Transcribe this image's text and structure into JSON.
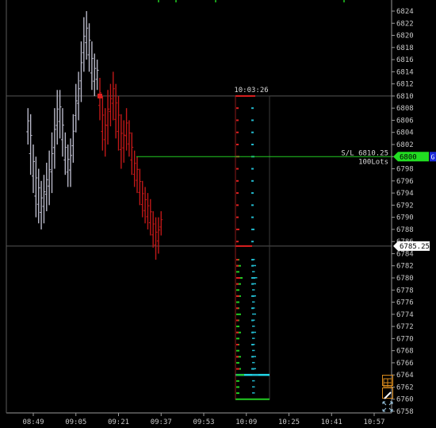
{
  "chart_data": {
    "type": "ohlc",
    "colors": {
      "background": "#000000",
      "bars_before": "#b8b8c8",
      "bars_after": "#c01818",
      "ladder_green": "#22cc22",
      "ladder_cyan": "#22b8cc",
      "sl_line": "#22cc22",
      "price_marker": "#ffffff",
      "tool_orange": "#d98a1c"
    },
    "ylim": [
      6757,
      6826
    ],
    "y_ticks": [
      "6824",
      "6822",
      "6820",
      "6818",
      "6816",
      "6814",
      "6812",
      "6810",
      "6808",
      "6806",
      "6804",
      "6802",
      "6800",
      "6798",
      "6796",
      "6794",
      "6792",
      "6790",
      "6788",
      "6786",
      "6784",
      "6782",
      "6780",
      "6778",
      "6776",
      "6774",
      "6772",
      "6770",
      "6768",
      "6766",
      "6764",
      "6762",
      "6760",
      "6758"
    ],
    "x_ticks": [
      "08:49",
      "09:05",
      "09:21",
      "09:37",
      "09:53",
      "10:09",
      "10:25",
      "10:41",
      "10:57"
    ],
    "x_tick_minutes": [
      529,
      545,
      561,
      577,
      593,
      609,
      625,
      641,
      657
    ],
    "xlim": [
      519,
      666
    ],
    "bars": [
      [
        527,
        6802,
        6808
      ],
      [
        528,
        6797,
        6807
      ],
      [
        529,
        6794,
        6802
      ],
      [
        530,
        6790,
        6800
      ],
      [
        531,
        6789,
        6798
      ],
      [
        532,
        6788,
        6796
      ],
      [
        533,
        6789,
        6797
      ],
      [
        534,
        6791,
        6799
      ],
      [
        535,
        6792,
        6801
      ],
      [
        536,
        6794,
        6804
      ],
      [
        537,
        6798,
        6808
      ],
      [
        538,
        6802,
        6811
      ],
      [
        539,
        6803,
        6811
      ],
      [
        540,
        6800,
        6808
      ],
      [
        541,
        6797,
        6804
      ],
      [
        542,
        6795,
        6802
      ],
      [
        543,
        6795,
        6803
      ],
      [
        544,
        6799,
        6807
      ],
      [
        545,
        6804,
        6812
      ],
      [
        546,
        6806,
        6814
      ],
      [
        547,
        6809,
        6819
      ],
      [
        548,
        6814,
        6823
      ],
      [
        549,
        6816,
        6824
      ],
      [
        550,
        6814,
        6822
      ],
      [
        551,
        6811,
        6819
      ],
      [
        552,
        6810,
        6817
      ],
      [
        553,
        6811,
        6816
      ],
      [
        554,
        6806,
        6813
      ],
      [
        555,
        6801,
        6810
      ],
      [
        556,
        6800,
        6808
      ],
      [
        557,
        6802,
        6811
      ],
      [
        558,
        6805,
        6812
      ],
      [
        559,
        6806,
        6814
      ],
      [
        560,
        6803,
        6812
      ],
      [
        561,
        6801,
        6810
      ],
      [
        562,
        6798,
        6807
      ],
      [
        563,
        6799,
        6806
      ],
      [
        564,
        6801,
        6808
      ],
      [
        565,
        6800,
        6806
      ],
      [
        566,
        6797,
        6804
      ],
      [
        567,
        6795,
        6801
      ],
      [
        568,
        6794,
        6800
      ],
      [
        569,
        6792,
        6798
      ],
      [
        570,
        6790,
        6796
      ],
      [
        571,
        6789,
        6795
      ],
      [
        572,
        6788,
        6794
      ],
      [
        573,
        6787,
        6793
      ],
      [
        574,
        6785,
        6791
      ],
      [
        575,
        6783,
        6790
      ],
      [
        576,
        6784,
        6790
      ],
      [
        577,
        6787,
        6791
      ]
    ],
    "divider_minute": 554,
    "ladder": {
      "time_label": "10:03:26",
      "top": 6810,
      "last": 6785.25,
      "bottom": 6760,
      "cyan_line": 6764,
      "bid_levels": [
        6783,
        6782,
        6781,
        6780,
        6779,
        6778,
        6777,
        6776,
        6775,
        6774,
        6773,
        6772,
        6771,
        6770,
        6769,
        6768,
        6767,
        6766,
        6765,
        6764,
        6763,
        6762,
        6761
      ],
      "bid_sizes": [
        1,
        2,
        1,
        3,
        2,
        1,
        2,
        1,
        1,
        2,
        1,
        1,
        2,
        1,
        1,
        1,
        2,
        1,
        2,
        4,
        1,
        1,
        1
      ],
      "ask_levels": [
        6808,
        6806,
        6804,
        6802,
        6800,
        6798,
        6796,
        6794,
        6792,
        6790,
        6788,
        6786,
        6783,
        6782,
        6780,
        6779,
        6777,
        6775,
        6773,
        6771,
        6769,
        6767,
        6765
      ],
      "ask_sizes": [
        1,
        1,
        1,
        1,
        2,
        1,
        1,
        1,
        1,
        1,
        2,
        1,
        1,
        1,
        3,
        1,
        2,
        1,
        1,
        1,
        1,
        1,
        2
      ]
    },
    "horizontal_lines": [
      6810,
      6785.25
    ],
    "sl_line": {
      "price": 6800,
      "label_top": "S/L 6810.25",
      "label_bottom": "100Lots"
    },
    "price_marker": "6785.25",
    "current_price_tag": "6800",
    "current_tag_suffix": "G"
  },
  "toolbar": {
    "icons": [
      "crosshair-icon",
      "draw-line-icon",
      "expand-icon"
    ]
  }
}
